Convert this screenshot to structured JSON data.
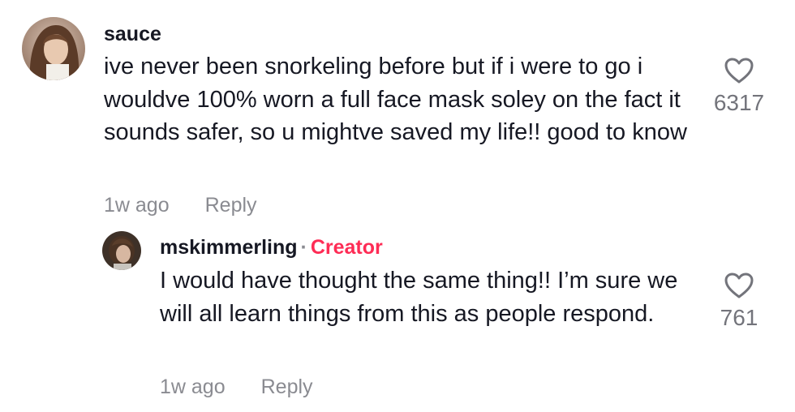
{
  "comments": [
    {
      "username": "sauce",
      "text": "ive never been snorkeling before but if i were to go i wouldve 100% worn a full face mask soley on the fact it sounds safer, so u mightve saved my life!! good to know",
      "time": "1w ago",
      "reply_label": "Reply",
      "likes": "6317"
    }
  ],
  "replies": [
    {
      "username": "mskimmerling",
      "separator": "·",
      "badge": "Creator",
      "text": "I would have thought the same thing!! I’m sure we will all learn things from this as people respond.",
      "time": "1w ago",
      "reply_label": "Reply",
      "likes": "761"
    }
  ],
  "colors": {
    "creator": "#fe2c55",
    "muted": "#8a8b91",
    "text": "#161823"
  }
}
